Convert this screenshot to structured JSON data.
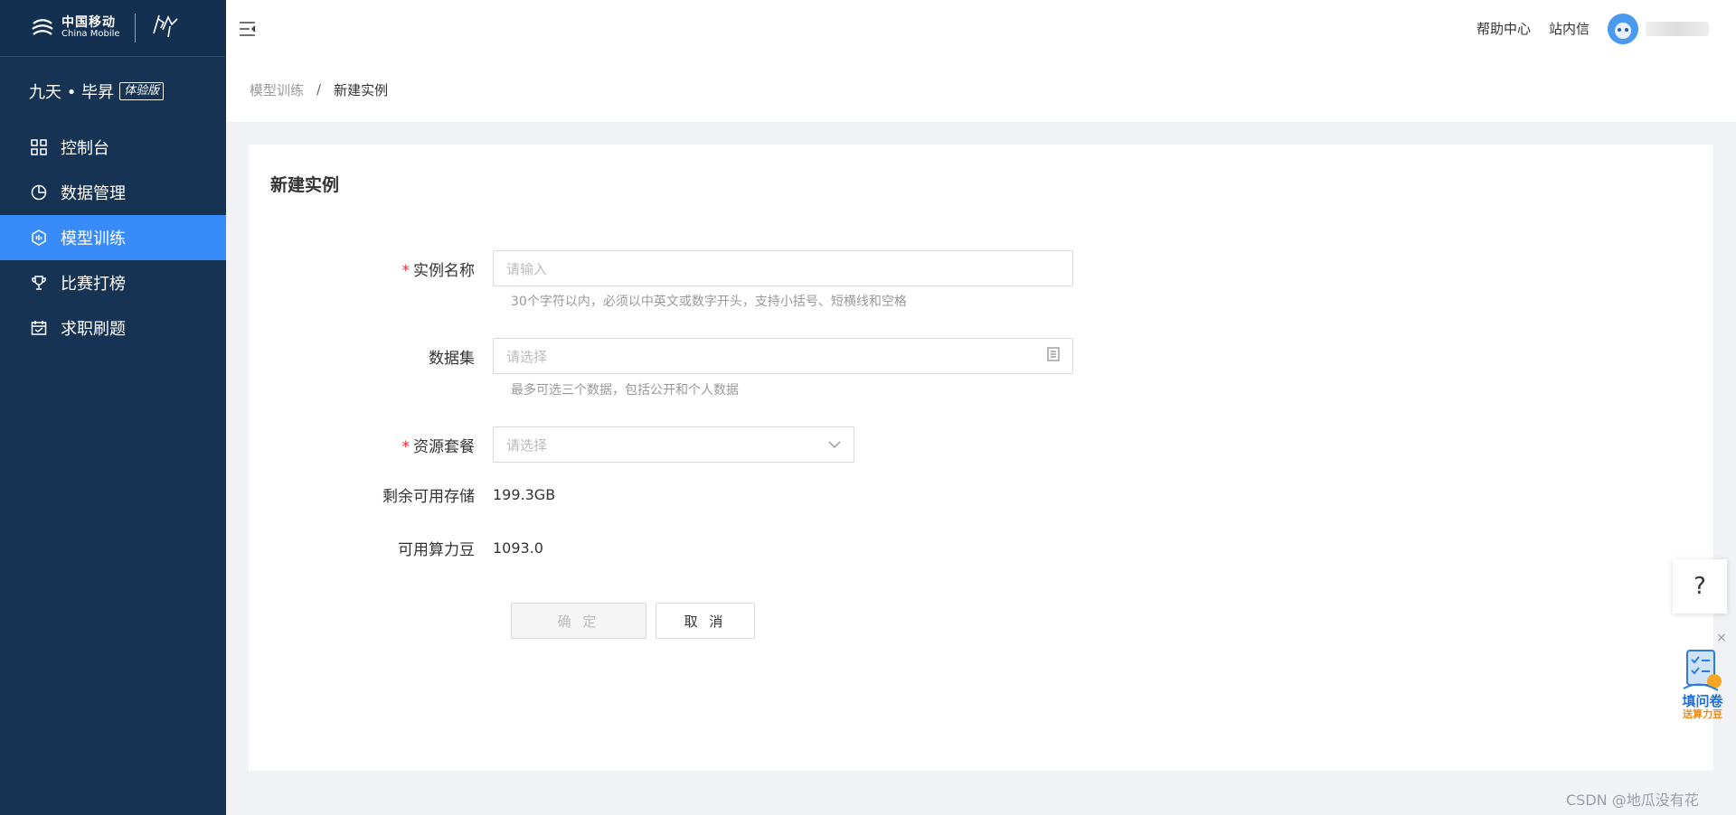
{
  "logo": {
    "cn": "中国移动",
    "en": "China Mobile"
  },
  "brand": {
    "name": "九天 • 毕昇",
    "badge": "体验版"
  },
  "sidebar": {
    "items": [
      {
        "label": "控制台",
        "icon": "dashboard-icon"
      },
      {
        "label": "数据管理",
        "icon": "pie-chart-icon"
      },
      {
        "label": "模型训练",
        "icon": "model-training-icon",
        "active": true
      },
      {
        "label": "比赛打榜",
        "icon": "trophy-icon"
      },
      {
        "label": "求职刷题",
        "icon": "calendar-icon"
      }
    ]
  },
  "header": {
    "help": "帮助中心",
    "messages": "站内信"
  },
  "breadcrumb": {
    "parent": "模型训练",
    "sep": "/",
    "current": "新建实例"
  },
  "form": {
    "title": "新建实例",
    "name": {
      "label": "实例名称",
      "required": "*",
      "placeholder": "请输入",
      "hint": "30个字符以内，必须以中英文或数字开头，支持小括号、短横线和空格"
    },
    "dataset": {
      "label": "数据集",
      "placeholder": "请选择",
      "hint": "最多可选三个数据，包括公开和个人数据"
    },
    "package": {
      "label": "资源套餐",
      "required": "*",
      "placeholder": "请选择"
    },
    "storage": {
      "label": "剩余可用存储",
      "value": "199.3GB"
    },
    "beans": {
      "label": "可用算力豆",
      "value": "1093.0"
    },
    "ok": "确 定",
    "cancel": "取 消"
  },
  "float": {
    "help": "?",
    "close": "×",
    "survey_line1": "填问卷",
    "survey_line2": "送算力豆"
  },
  "watermark": "CSDN @地瓜没有花",
  "colors": {
    "sidebar": "#163354",
    "active": "#3a8bfa",
    "required": "#f5222d"
  }
}
